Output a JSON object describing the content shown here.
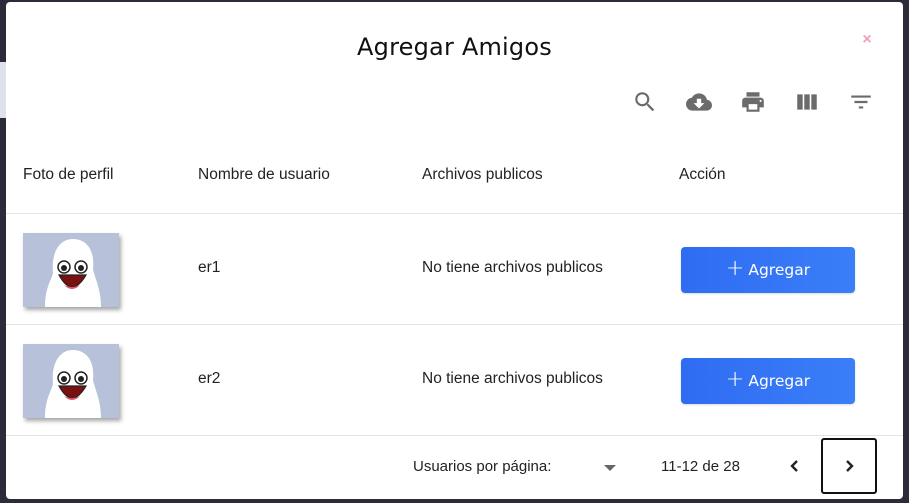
{
  "modal": {
    "title": "Agregar Amigos",
    "close_glyph": "×",
    "toolbar": [
      "search-icon",
      "cloud-download-icon",
      "print-icon",
      "view-columns-icon",
      "filter-icon"
    ]
  },
  "table": {
    "headers": {
      "photo": "Foto de perfil",
      "username": "Nombre de usuario",
      "files": "Archivos publicos",
      "action": "Acción"
    },
    "rows": [
      {
        "username": "er1",
        "files": "No tiene archivos publicos",
        "action_label": "Agregar"
      },
      {
        "username": "er2",
        "files": "No tiene archivos publicos",
        "action_label": "Agregar"
      }
    ]
  },
  "pagination": {
    "per_page_label": "Usuarios por página:",
    "range": "11-12 de 28"
  },
  "colors": {
    "accent": "#2f6cf2",
    "close": "#f2a0b8",
    "avatar_bg": "#b7c1d9"
  }
}
